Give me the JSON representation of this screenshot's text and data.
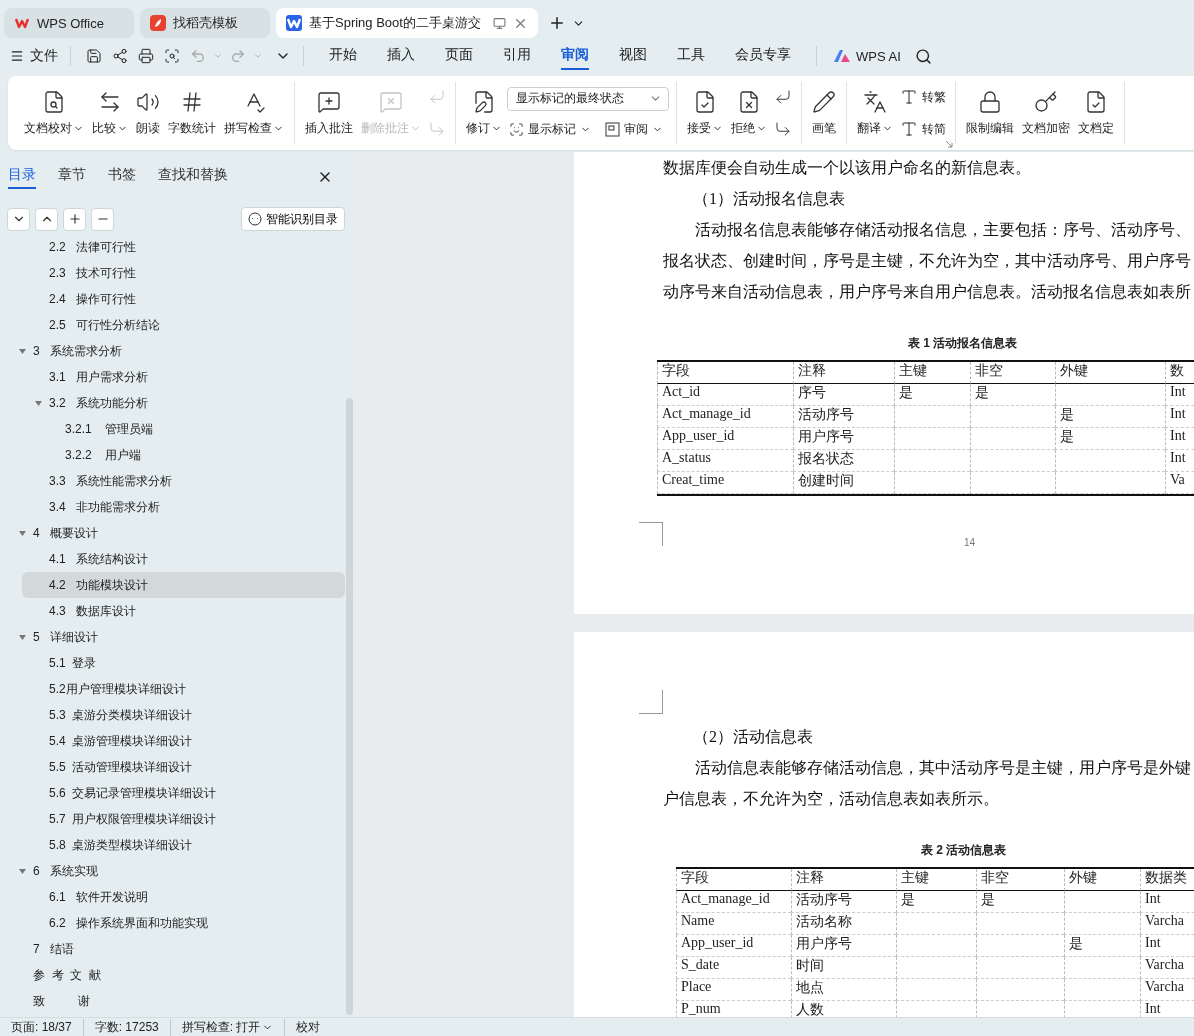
{
  "browser_tabs": [
    {
      "label": "WPS Office",
      "selected": false,
      "kind": "home"
    },
    {
      "label": "找稻壳模板",
      "selected": false,
      "kind": "template"
    },
    {
      "label": "基于Spring Boot的二手桌游交",
      "selected": true,
      "kind": "document"
    }
  ],
  "menu": {
    "file": "文件",
    "tabs": [
      {
        "label": "开始",
        "selected": false
      },
      {
        "label": "插入",
        "selected": false
      },
      {
        "label": "页面",
        "selected": false
      },
      {
        "label": "引用",
        "selected": false
      },
      {
        "label": "审阅",
        "selected": true
      },
      {
        "label": "视图",
        "selected": false
      },
      {
        "label": "工具",
        "selected": false
      },
      {
        "label": "会员专享",
        "selected": false
      }
    ],
    "ai": "WPS AI"
  },
  "ribbon": {
    "groups": [
      {
        "items": [
          {
            "kind": "large",
            "label": "文档校对",
            "dropdown": true,
            "disabled": false
          },
          {
            "kind": "large",
            "label": "比较",
            "dropdown": true,
            "disabled": false
          },
          {
            "kind": "large",
            "label": "朗读",
            "dropdown": false,
            "disabled": false
          },
          {
            "kind": "large",
            "label": "字数统计",
            "dropdown": false,
            "disabled": false
          },
          {
            "kind": "large",
            "label": "拼写检查",
            "dropdown": true,
            "disabled": false
          }
        ]
      },
      {
        "items": [
          {
            "kind": "large",
            "label": "插入批注",
            "dropdown": false,
            "disabled": false
          },
          {
            "kind": "large",
            "label": "删除批注",
            "dropdown": true,
            "disabled": true
          },
          {
            "kind": "stack",
            "disabled": true
          }
        ]
      },
      {
        "items": [
          {
            "kind": "large",
            "label": "修订",
            "dropdown": true,
            "disabled": false
          },
          {
            "kind": "select",
            "value": "显示标记的最终状态",
            "buttons": [
              {
                "label": "显示标记",
                "dropdown": true
              },
              {
                "label": "审阅",
                "dropdown": true
              }
            ]
          }
        ]
      },
      {
        "items": [
          {
            "kind": "large",
            "label": "接受",
            "dropdown": true,
            "disabled": false
          },
          {
            "kind": "large",
            "label": "拒绝",
            "dropdown": true,
            "disabled": false
          },
          {
            "kind": "stack",
            "disabled": false
          }
        ]
      },
      {
        "items": [
          {
            "kind": "large",
            "label": "画笔",
            "dropdown": false,
            "disabled": false
          }
        ]
      },
      {
        "launcher": true,
        "items": [
          {
            "kind": "large",
            "label": "翻译",
            "dropdown": true,
            "disabled": false
          },
          {
            "kind": "pair",
            "buttons": [
              {
                "label": "转繁",
                "dropdown": false
              },
              {
                "label": "转简",
                "dropdown": false
              }
            ]
          }
        ]
      },
      {
        "items": [
          {
            "kind": "large",
            "label": "限制编辑",
            "dropdown": false,
            "disabled": false
          },
          {
            "kind": "large",
            "label": "文档加密",
            "dropdown": false,
            "disabled": false
          },
          {
            "kind": "large",
            "label": "文档定",
            "dropdown": false,
            "disabled": false
          }
        ]
      }
    ]
  },
  "sidebar": {
    "tabs": [
      {
        "label": "目录",
        "selected": true
      },
      {
        "label": "章节",
        "selected": false
      },
      {
        "label": "书签",
        "selected": false
      },
      {
        "label": "查找和替换",
        "selected": false
      }
    ],
    "smart_toc_button": "智能识别目录",
    "toc": {
      "continued": [
        {
          "label": "2.2   法律可行性",
          "selected": false
        },
        {
          "label": "2.3   技术可行性",
          "selected": false
        },
        {
          "label": "2.4   操作可行性",
          "selected": false
        },
        {
          "label": "2.5   可行性分析结论",
          "selected": false
        }
      ],
      "items": [
        {
          "label": "3   系统需求分析",
          "selected": false,
          "expanded": true,
          "children": [
            {
              "label": "3.1   用户需求分析",
              "selected": false
            },
            {
              "label": "3.2   系统功能分析",
              "selected": false,
              "expanded": true,
              "children": [
                {
                  "label": "3.2.1    管理员端",
                  "selected": false
                },
                {
                  "label": "3.2.2    用户端",
                  "selected": false
                }
              ]
            },
            {
              "label": "3.3   系统性能需求分析",
              "selected": false
            },
            {
              "label": "3.4   非功能需求分析",
              "selected": false
            }
          ]
        },
        {
          "label": "4   概要设计",
          "selected": false,
          "expanded": true,
          "children": [
            {
              "label": "4.1   系统结构设计",
              "selected": false
            },
            {
              "label": "4.2   功能模块设计",
              "selected": true
            },
            {
              "label": "4.3   数据库设计",
              "selected": false
            }
          ]
        },
        {
          "label": "5   详细设计",
          "selected": false,
          "expanded": true,
          "children": [
            {
              "label": "5.1  登录",
              "selected": false
            },
            {
              "label": "5.2用户管理模块详细设计",
              "selected": false
            },
            {
              "label": "5.3  桌游分类模块详细设计",
              "selected": false
            },
            {
              "label": "5.4  桌游管理模块详细设计",
              "selected": false
            },
            {
              "label": "5.5  活动管理模块详细设计",
              "selected": false
            },
            {
              "label": "5.6  交易记录管理模块详细设计",
              "selected": false
            },
            {
              "label": "5.7  用户权限管理模块详细设计",
              "selected": false
            },
            {
              "label": "5.8  桌游类型模块详细设计",
              "selected": false
            }
          ]
        },
        {
          "label": "6   系统实现",
          "selected": false,
          "expanded": true,
          "children": [
            {
              "label": "6.1   软件开发说明",
              "selected": false
            },
            {
              "label": "6.2   操作系统界面和功能实现",
              "selected": false
            }
          ]
        },
        {
          "label": "7   结语",
          "selected": false
        },
        {
          "label": "参  考  文  献",
          "selected": false
        },
        {
          "label": "致          谢",
          "selected": false
        }
      ]
    }
  },
  "document": {
    "pages": [
      {
        "page_number": "14",
        "blocks": [
          {
            "kind": "para",
            "lines": [
              "数据库便会自动生成一个以该用户命名的新信息表。"
            ]
          },
          {
            "kind": "heading",
            "text": "（1）活动报名信息表"
          },
          {
            "kind": "para",
            "lines": [
              "活动报名信息表能够存储活动报名信息，主要包括：序号、活动序号、",
              "报名状态、创建时间，序号是主键，不允许为空，其中活动序号、用户序号",
              "动序号来自活动信息表，用户序号来自用户信息表。活动报名信息表如表所"
            ]
          },
          {
            "kind": "caption",
            "text": "表 1 活动报名信息表"
          },
          {
            "kind": "table",
            "columns": [
              "字段",
              "注释",
              "主键",
              "非空",
              "外键",
              "数"
            ],
            "rows": [
              [
                "Act_id",
                "序号",
                "是",
                "是",
                "",
                "Int"
              ],
              [
                "Act_manage_id",
                "活动序号",
                "",
                "",
                "是",
                "Int"
              ],
              [
                "App_user_id",
                "用户序号",
                "",
                "",
                "是",
                "Int"
              ],
              [
                "A_status",
                "报名状态",
                "",
                "",
                "",
                "Int"
              ],
              [
                "Creat_time",
                "创建时间",
                "",
                "",
                "",
                "Va"
              ]
            ]
          }
        ]
      },
      {
        "blocks": [
          {
            "kind": "heading",
            "text": "（2）活动信息表"
          },
          {
            "kind": "para",
            "lines": [
              "活动信息表能够存储活动信息，其中活动序号是主键，用户序号是外键",
              "户信息表，不允许为空，活动信息表如表所示。"
            ]
          },
          {
            "kind": "caption",
            "text": "表 2 活动信息表"
          },
          {
            "kind": "table",
            "columns": [
              "字段",
              "注释",
              "主键",
              "非空",
              "外键",
              "数据类"
            ],
            "rows": [
              [
                "Act_manage_id",
                "活动序号",
                "是",
                "是",
                "",
                "Int"
              ],
              [
                "Name",
                "活动名称",
                "",
                "",
                "",
                "Varcha"
              ],
              [
                "App_user_id",
                "用户序号",
                "",
                "",
                "是",
                "Int"
              ],
              [
                "S_date",
                "时间",
                "",
                "",
                "",
                "Varcha"
              ],
              [
                "Place",
                "地点",
                "",
                "",
                "",
                "Varcha"
              ],
              [
                "P_num",
                "人数",
                "",
                "",
                "",
                "Int"
              ]
            ]
          }
        ]
      }
    ]
  },
  "status_bar": [
    {
      "label": "页面: 18/37",
      "dropdown": false
    },
    {
      "label": "字数: 17253",
      "dropdown": false
    },
    {
      "label": "拼写检查: 打开",
      "dropdown": true
    },
    {
      "label": "校对",
      "dropdown": false
    }
  ]
}
